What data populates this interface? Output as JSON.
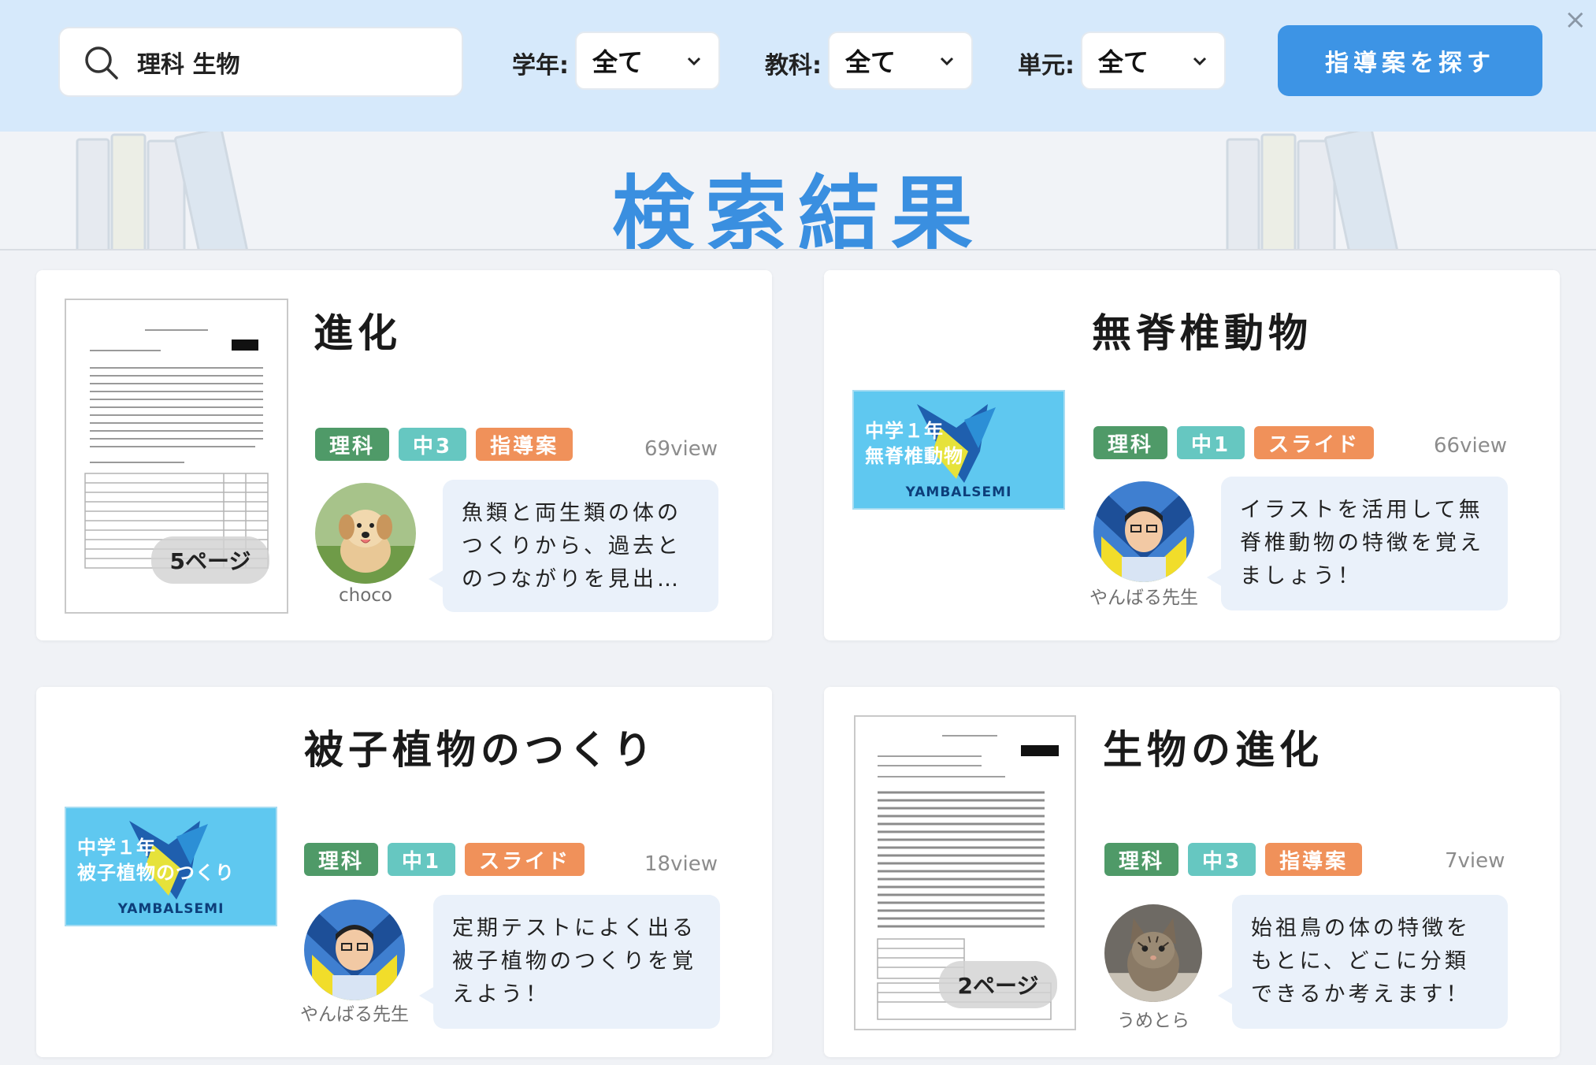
{
  "search": {
    "query": "理科 生物",
    "filters": [
      {
        "label": "学年:",
        "value": "全て"
      },
      {
        "label": "教科:",
        "value": "全て"
      },
      {
        "label": "単元:",
        "value": "全て"
      }
    ],
    "button_label": "指導案を探す"
  },
  "close_label": "×",
  "results_title": "検索結果",
  "colors": {
    "accent": "#3d94e5",
    "subject_tag": "#4f9a68",
    "grade_tag": "#66c7c1",
    "kind_tag": "#f0915a"
  },
  "cards": [
    {
      "title": "進化",
      "thumb_type": "document",
      "page_badge": "5ページ",
      "tags": [
        "理科",
        "中3",
        "指導案"
      ],
      "views": "69view",
      "author": "choco",
      "avatar": "puppy-photo",
      "description": "魚類と両生類の体のつくりから、過去とのつながりを見出…"
    },
    {
      "title": "無脊椎動物",
      "thumb_type": "slide",
      "slide_lines": [
        "中学１年",
        "無脊椎動物"
      ],
      "slide_brand": "YAMBALSEMI",
      "tags": [
        "理科",
        "中1",
        "スライド"
      ],
      "views": "66view",
      "author": "やんばる先生",
      "avatar": "teacher-photo",
      "description": "イラストを活用して無脊椎動物の特徴を覚えましょう！"
    },
    {
      "title": "被子植物のつくり",
      "thumb_type": "slide",
      "slide_lines": [
        "中学１年",
        "被子植物のつくり"
      ],
      "slide_brand": "YAMBALSEMI",
      "tags": [
        "理科",
        "中1",
        "スライド"
      ],
      "views": "18view",
      "author": "やんばる先生",
      "avatar": "teacher-photo",
      "description": "定期テストによく出る被子植物のつくりを覚えよう！"
    },
    {
      "title": "生物の進化",
      "thumb_type": "document",
      "page_badge": "2ページ",
      "tags": [
        "理科",
        "中3",
        "指導案"
      ],
      "views": "7view",
      "author": "うめとら",
      "avatar": "cat-photo",
      "description": "始祖鳥の体の特徴をもとに、どこに分類できるか考えます！"
    }
  ]
}
